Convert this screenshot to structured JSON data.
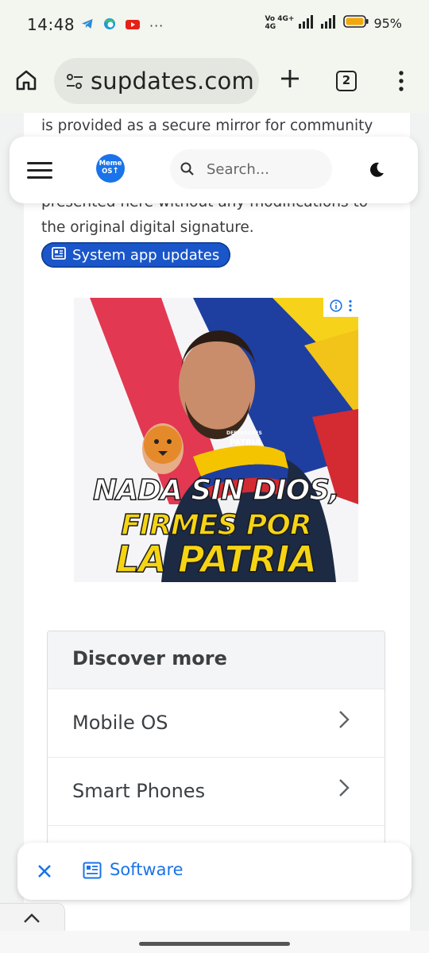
{
  "status_bar": {
    "time": "14:48",
    "network_top": "Vo 4G+",
    "network_bottom": "4G",
    "battery_percent": "95%",
    "app_icons": [
      "telegram-icon",
      "edge-icon",
      "youtube-icon",
      "more-dots"
    ]
  },
  "browser": {
    "url": "supdates.com",
    "tab_count": "2"
  },
  "site_header": {
    "logo_text_top": "Meme",
    "logo_text_bottom": "OS",
    "search_placeholder": "Search..."
  },
  "article": {
    "line1": "is provided as a secure mirror for community",
    "line2": "presented here without any modifications to",
    "line3": "the original digital signature.",
    "category": "System app updates"
  },
  "ad": {
    "badge_text": "DEFENSORES",
    "badge_title": "PATRIA",
    "line1": "NADA SIN DIOS,",
    "line2": "FIRMES POR",
    "line3": "LA PATRIA"
  },
  "discover": {
    "heading": "Discover more",
    "items": [
      "Mobile OS",
      "Smart Phones"
    ]
  },
  "float_bar": {
    "label": "Software"
  },
  "colors": {
    "accent": "#1a73e8",
    "pill": "#1a56c9"
  }
}
